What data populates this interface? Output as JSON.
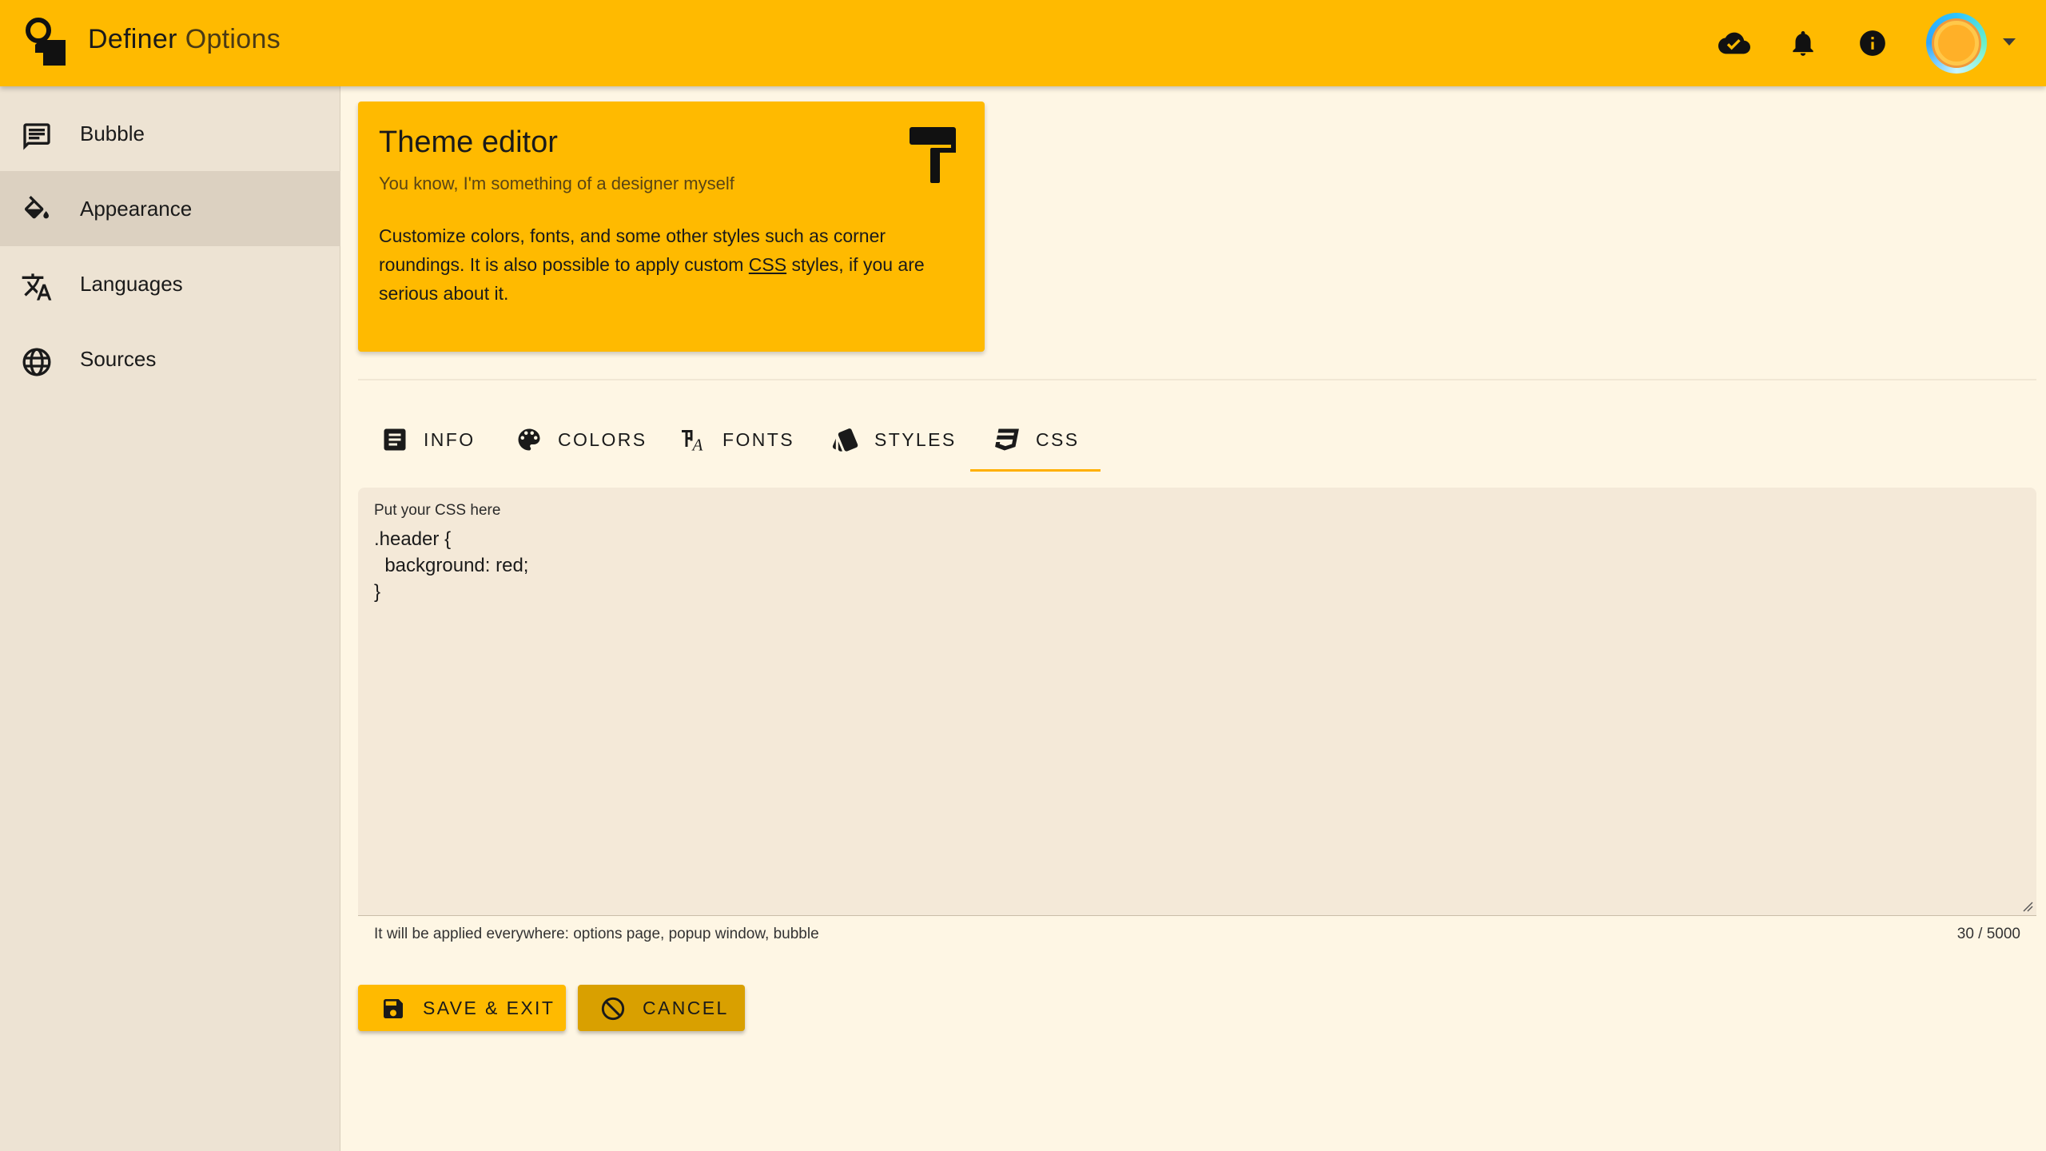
{
  "app": {
    "title_main": "Definer",
    "title_sub": "Options"
  },
  "appbar": {
    "icons": [
      "cloud-done-icon",
      "bell-icon",
      "info-icon"
    ],
    "accent": "#ffba00"
  },
  "sidebar": {
    "items": [
      {
        "label": "Bubble",
        "icon": "message-icon",
        "active": false
      },
      {
        "label": "Appearance",
        "icon": "paint-bucket-icon",
        "active": true
      },
      {
        "label": "Languages",
        "icon": "translate-icon",
        "active": false
      },
      {
        "label": "Sources",
        "icon": "globe-icon",
        "active": false
      }
    ]
  },
  "card": {
    "title": "Theme editor",
    "subtitle": "You know, I'm something of a designer myself",
    "body_before": "Customize colors, fonts, and some other styles such as corner roundings. It is also possible to apply custom ",
    "body_link": "CSS",
    "body_after": " styles, if you are serious about it."
  },
  "tabs": [
    {
      "label": "INFO",
      "icon": "article-icon"
    },
    {
      "label": "COLORS",
      "icon": "palette-icon"
    },
    {
      "label": "FONTS",
      "icon": "font-icon"
    },
    {
      "label": "STYLES",
      "icon": "style-icon"
    },
    {
      "label": "CSS",
      "icon": "css-icon",
      "active": true
    }
  ],
  "css_field": {
    "label": "Put your CSS here",
    "value": ".header {\n  background: red;\n}",
    "hint": "It will be applied everywhere: options page, popup window, bubble",
    "counter": "30 / 5000"
  },
  "actions": {
    "save_label": "SAVE & EXIT",
    "cancel_label": "CANCEL"
  }
}
